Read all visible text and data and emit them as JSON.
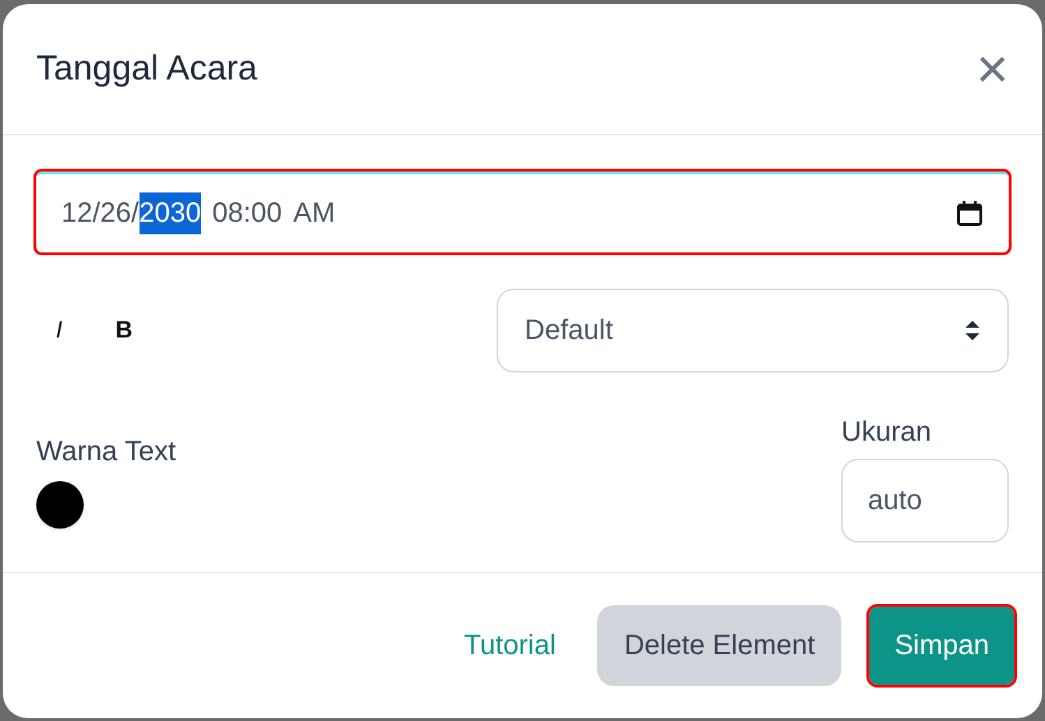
{
  "dialog": {
    "title": "Tanggal Acara",
    "close": "×"
  },
  "date_field": {
    "highlighted": true,
    "segments": [
      {
        "text": "12/26/",
        "selected": false
      },
      {
        "text": "2030",
        "selected": true
      },
      {
        "text": "08:00",
        "selected": false
      },
      {
        "text": "AM",
        "selected": false
      }
    ]
  },
  "format_buttons": [
    {
      "label": "I",
      "kind": "italic"
    },
    {
      "label": "B",
      "kind": "bold"
    }
  ],
  "font_select": {
    "value": "Default"
  },
  "text_color": {
    "label": "Warna Text",
    "color": "#000000"
  },
  "size": {
    "label": "Ukuran",
    "value": "auto"
  },
  "footer": {
    "tutorial": "Tutorial",
    "delete": "Delete Element",
    "save": {
      "label": "Simpan",
      "highlighted": true
    }
  }
}
